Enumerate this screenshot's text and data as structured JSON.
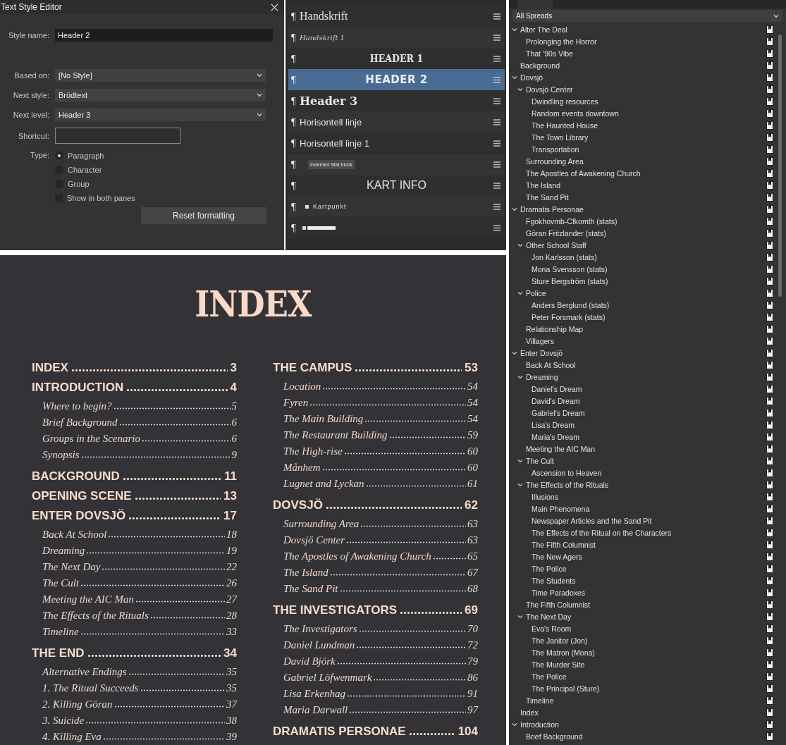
{
  "dialog": {
    "title": "Text Style Editor",
    "style_name": {
      "label": "Style name:",
      "value": "Header 2"
    },
    "based_on": {
      "label": "Based on:",
      "value": "[No Style]"
    },
    "next_style": {
      "label": "Next style:",
      "value": "Brödtext"
    },
    "next_level": {
      "label": "Next level:",
      "value": "Header 3"
    },
    "shortcut": {
      "label": "Shortcut:"
    },
    "type": {
      "label": "Type:",
      "options": [
        {
          "label": "Paragraph",
          "selected": true
        },
        {
          "label": "Character",
          "selected": false
        },
        {
          "label": "Group",
          "selected": false
        }
      ]
    },
    "show_in_both_panes": {
      "label": "Show in both panes",
      "checked": false
    },
    "reset_button": "Reset formatting"
  },
  "styles": [
    {
      "marker": "¶",
      "name": "Handskrift",
      "kind": "serif",
      "selected": false
    },
    {
      "marker": "¶",
      "name": "Handskrift 1",
      "kind": "script",
      "selected": false
    },
    {
      "marker": "¶",
      "name": "HEADER 1",
      "kind": "display",
      "selected": false
    },
    {
      "marker": "¶",
      "name": "HEADER 2",
      "kind": "heading",
      "selected": true
    },
    {
      "marker": "¶",
      "name": "Header 3",
      "kind": "serif-bold",
      "selected": false
    },
    {
      "marker": "¶",
      "name": "Horisontell linje",
      "kind": "sans",
      "selected": false
    },
    {
      "marker": "¶",
      "name": "Horisontell linje 1",
      "kind": "sans",
      "selected": false
    },
    {
      "marker": "¶",
      "name": "Indented Stat block",
      "kind": "tag",
      "selected": false
    },
    {
      "marker": "¶",
      "name": "KART INFO",
      "kind": "caps",
      "selected": false
    },
    {
      "marker": "¶",
      "name": "Kartpunkt",
      "kind": "bullet",
      "selected": false
    },
    {
      "marker": "¶",
      "kind": "unreadable",
      "selected": false
    }
  ],
  "index": {
    "title": "INDEX",
    "columns": [
      [
        {
          "title": "INDEX",
          "page": "3"
        },
        {
          "title": "INTRODUCTION",
          "page": "4",
          "entries": [
            {
              "title": "Where to begin?",
              "page": "5"
            },
            {
              "title": "Brief Background",
              "page": "6"
            },
            {
              "title": "Groups in the Scenario",
              "page": "6"
            },
            {
              "title": "Synopsis",
              "page": "9"
            }
          ]
        },
        {
          "title": "BACKGROUND",
          "page": "11"
        },
        {
          "title": "OPENING SCENE",
          "page": "13"
        },
        {
          "title": "ENTER DOVSJÖ",
          "page": "17",
          "entries": [
            {
              "title": "Back At School",
              "page": "18"
            },
            {
              "title": "Dreaming",
              "page": "19"
            },
            {
              "title": "The Next Day",
              "page": "22"
            },
            {
              "title": "The Cult",
              "page": "26"
            },
            {
              "title": "Meeting the AIC Man",
              "page": "27"
            },
            {
              "title": "The Effects of the Rituals",
              "page": "28"
            },
            {
              "title": "Timeline",
              "page": "33"
            }
          ]
        },
        {
          "title": "THE END",
          "page": "34",
          "entries": [
            {
              "title": "Alternative Endings",
              "page": "35"
            },
            {
              "title": "1. The Ritual Succeeds",
              "page": "35"
            },
            {
              "title": "2. Killing Göran",
              "page": "37"
            },
            {
              "title": "3. Suicide",
              "page": "38"
            },
            {
              "title": "4. Killing Eva",
              "page": "39"
            }
          ]
        }
      ],
      [
        {
          "title": "THE CAMPUS",
          "page": "53",
          "entries": [
            {
              "title": "Location",
              "page": "54"
            },
            {
              "title": "Fyren",
              "page": "54"
            },
            {
              "title": "The Main Building",
              "page": "54"
            },
            {
              "title": "The Restaurant Building",
              "page": "59"
            },
            {
              "title": "The High-rise",
              "page": "60"
            },
            {
              "title": "Månhem",
              "page": "60"
            },
            {
              "title": "Lugnet and Lyckan",
              "page": "61"
            }
          ]
        },
        {
          "title": "DOVSJÖ",
          "page": "62",
          "entries": [
            {
              "title": "Surrounding Area",
              "page": "63"
            },
            {
              "title": "Dovsjö Center",
              "page": "63"
            },
            {
              "title": "The Apostles of Awakening Church",
              "page": "65"
            },
            {
              "title": "The Island",
              "page": "67"
            },
            {
              "title": "The Sand Pit",
              "page": "68"
            }
          ]
        },
        {
          "title": "THE INVESTIGATORS",
          "page": "69",
          "entries": [
            {
              "title": "The Investigators",
              "page": "70"
            },
            {
              "title": "Daniel Lundman",
              "page": "72"
            },
            {
              "title": "David Björk",
              "page": "79"
            },
            {
              "title": "Gabriel Löfwenmark",
              "page": "86"
            },
            {
              "title": "Lisa Erkenhag",
              "page": "91"
            },
            {
              "title": "Maria Darwall",
              "page": "97"
            }
          ]
        },
        {
          "title": "DRAMATIS PERSONAE",
          "page": "104"
        }
      ]
    ]
  },
  "anchors": {
    "filter": "All Spreads",
    "tree": [
      {
        "label": "Alter The Deal",
        "expanded": true,
        "children": [
          {
            "label": "Prolonging the Horror"
          },
          {
            "label": "That ’90s Vibe"
          }
        ]
      },
      {
        "label": "Background"
      },
      {
        "label": "Dovsjö",
        "expanded": true,
        "children": [
          {
            "label": "Dovsjö Center",
            "expanded": true,
            "children": [
              {
                "label": "Dwindling resources"
              },
              {
                "label": "Random events downtown"
              },
              {
                "label": "The Haunted House"
              },
              {
                "label": "The Town Library"
              },
              {
                "label": "Transportation"
              }
            ]
          },
          {
            "label": "Surrounding Area"
          },
          {
            "label": "The Apostles of Awakening Church"
          },
          {
            "label": "The Island"
          },
          {
            "label": "The Sand Pit"
          }
        ]
      },
      {
        "label": "Dramatis Personae",
        "expanded": true,
        "children": [
          {
            "label": "Fgokhovmb-Cfkomth (stats)"
          },
          {
            "label": "Göran Fritzlander (stats)"
          },
          {
            "label": "Other School Staff",
            "expanded": true,
            "children": [
              {
                "label": "Jon Karlsson (stats)"
              },
              {
                "label": "Mona Svensson (stats)"
              },
              {
                "label": "Sture Bergström (stats)"
              }
            ]
          },
          {
            "label": "Police",
            "expanded": true,
            "children": [
              {
                "label": "Anders Berglund (stats)"
              },
              {
                "label": "Peter Forsmark (stats)"
              }
            ]
          },
          {
            "label": "Relationship Map"
          },
          {
            "label": "Villagers"
          }
        ]
      },
      {
        "label": "Enter Dovsjö",
        "expanded": true,
        "children": [
          {
            "label": "Back At School"
          },
          {
            "label": "Dreaming",
            "expanded": true,
            "children": [
              {
                "label": "Daniel's Dream"
              },
              {
                "label": "David's Dream"
              },
              {
                "label": "Gabriel's Dream"
              },
              {
                "label": "Lisa's Dream"
              },
              {
                "label": "Maria's Dream"
              }
            ]
          },
          {
            "label": "Meeting the AIC Man"
          },
          {
            "label": "The Cult",
            "expanded": true,
            "children": [
              {
                "label": "Ascension to Heaven"
              }
            ]
          },
          {
            "label": "The Effects of the Rituals",
            "expanded": true,
            "children": [
              {
                "label": "Illusions"
              },
              {
                "label": "Main Phenomena"
              },
              {
                "label": "Newspaper Articles and the Sand Pit"
              },
              {
                "label": "The Effects of the Ritual on the Characters"
              },
              {
                "label": "The Fifth Columnist"
              },
              {
                "label": "The New Agers"
              },
              {
                "label": "The Police"
              },
              {
                "label": "The Students"
              },
              {
                "label": "Time Paradoxes"
              }
            ]
          },
          {
            "label": "The Fifth Columnist"
          },
          {
            "label": "The Next Day",
            "expanded": true,
            "children": [
              {
                "label": "Eva's Room"
              },
              {
                "label": "The Janitor (Jon)"
              },
              {
                "label": "The Matron (Mona)"
              },
              {
                "label": "The Murder Site"
              },
              {
                "label": "The Police"
              },
              {
                "label": "The Principal (Sture)"
              }
            ]
          },
          {
            "label": "Timeline"
          }
        ]
      },
      {
        "label": "Index"
      },
      {
        "label": "Introduction",
        "expanded": true,
        "children": [
          {
            "label": "Brief Background"
          }
        ]
      }
    ]
  }
}
